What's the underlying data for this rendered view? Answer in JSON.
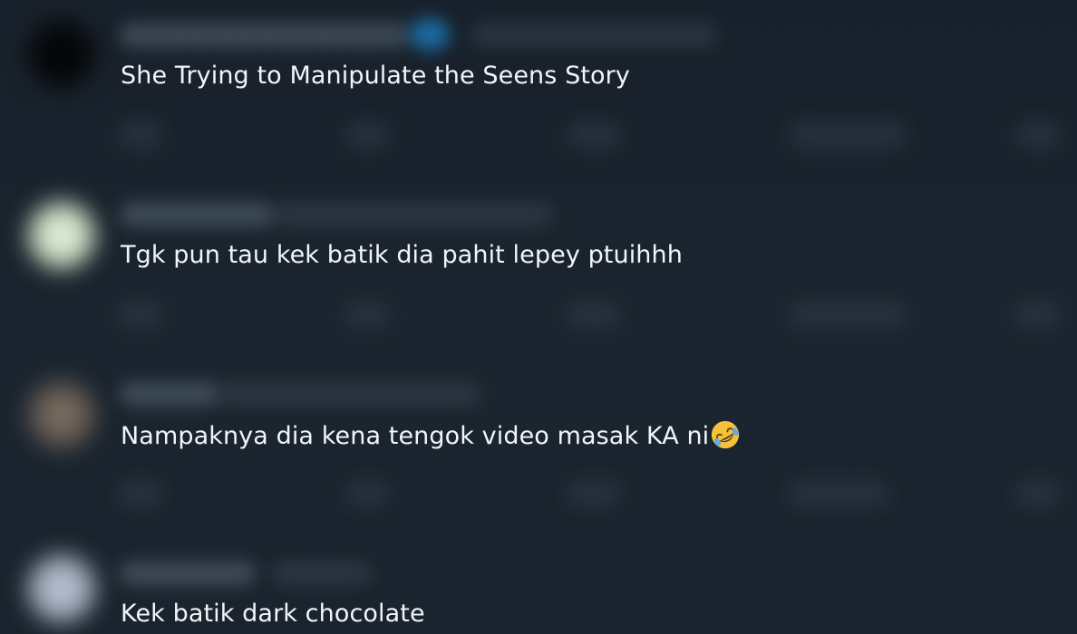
{
  "replies": [
    {
      "text": "She Trying to Manipulate the Seens Story",
      "emoji": ""
    },
    {
      "text": "Tgk pun tau kek batik dia pahit lepey ptuihhh",
      "emoji": ""
    },
    {
      "text": "Nampaknya dia kena tengok video masak KA ni",
      "emoji": "rolling-on-floor-laughing"
    },
    {
      "text": "Kek batik dark chocolate",
      "emoji": ""
    }
  ],
  "colors": {
    "background": "#1a232d",
    "text": "#f2f5f8",
    "accent_blur": "#1d9bf0"
  }
}
